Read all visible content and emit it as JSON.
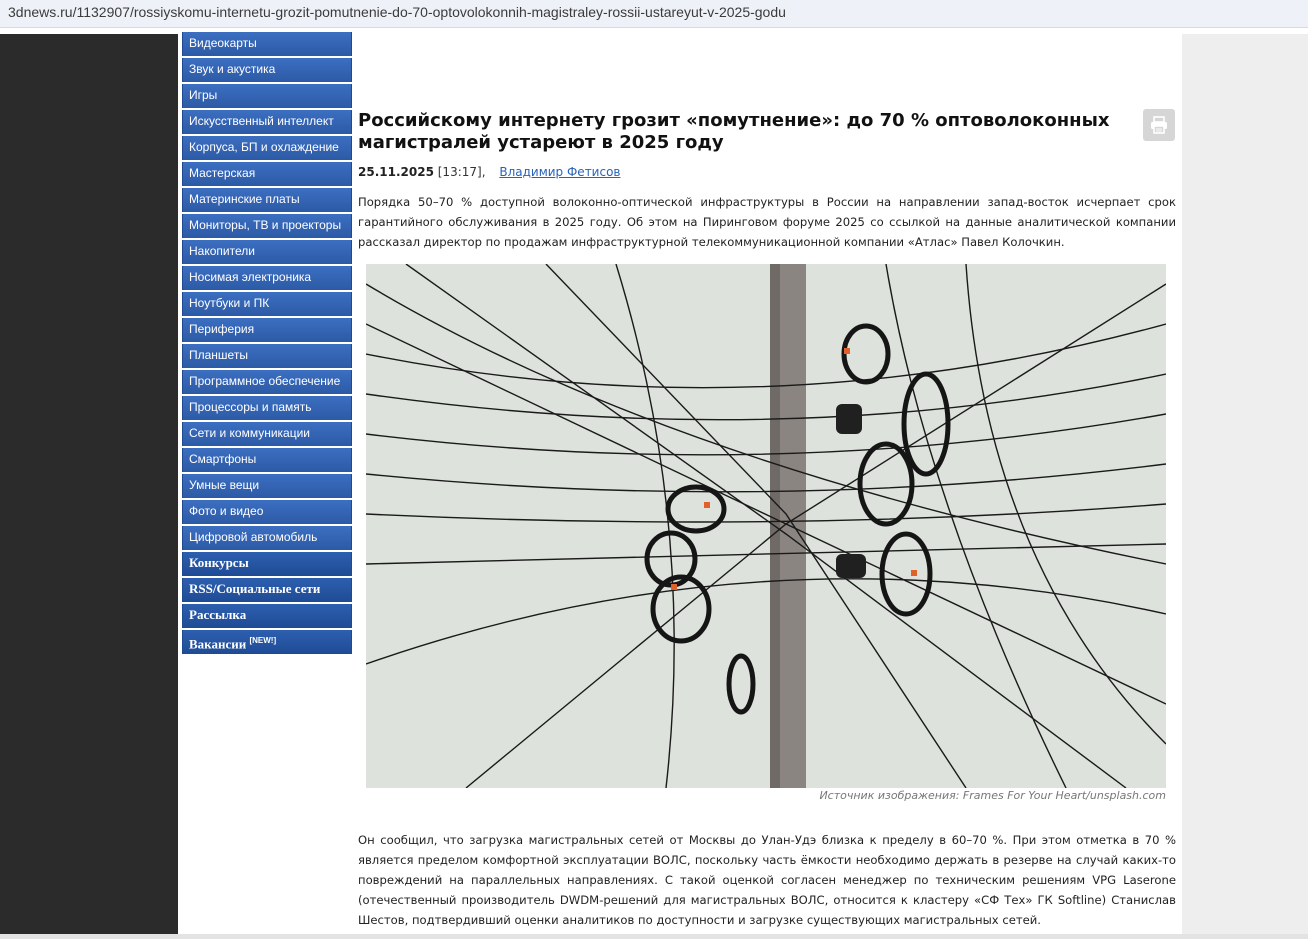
{
  "browser": {
    "url": "3dnews.ru/1132907/rossiyskomu-internetu-grozit-pomutnenie-do-70-optovolokonnih-magistraley-rossii-ustareyut-v-2025-godu"
  },
  "sidebar": {
    "items": [
      {
        "label": "Видеокарты"
      },
      {
        "label": "Звук и акустика"
      },
      {
        "label": "Игры"
      },
      {
        "label": "Искусственный интеллект"
      },
      {
        "label": "Корпуса, БП и охлаждение"
      },
      {
        "label": "Мастерская"
      },
      {
        "label": "Материнские платы"
      },
      {
        "label": "Мониторы, ТВ и проекторы"
      },
      {
        "label": "Накопители"
      },
      {
        "label": "Носимая электроника"
      },
      {
        "label": "Ноутбуки и ПК"
      },
      {
        "label": "Периферия"
      },
      {
        "label": "Планшеты"
      },
      {
        "label": "Программное обеспечение"
      },
      {
        "label": "Процессоры и память"
      },
      {
        "label": "Сети и коммуникации"
      },
      {
        "label": "Смартфоны"
      },
      {
        "label": "Умные вещи"
      },
      {
        "label": "Фото и видео"
      },
      {
        "label": "Цифровой автомобиль"
      }
    ],
    "bold_items": [
      {
        "label": "Конкурсы"
      },
      {
        "label": "RSS/Социальные сети"
      },
      {
        "label": "Рассылка"
      },
      {
        "label": "Вакансии",
        "badge": "[NEW!]"
      }
    ]
  },
  "article": {
    "title": "Российскому интернету грозит «помутнение»: до 70 % оптоволоконных магистралей устареют в 2025 году",
    "date": "25.11.2025",
    "time": "[13:17],",
    "author": "Владимир Фетисов",
    "lead": "Порядка 50–70 % доступной волоконно-оптической инфраструктуры в России на направлении запад-восток исчерпает срок гарантийного обслуживания в 2025 году. Об этом на Пиринговом форуме 2025 со ссылкой на данные аналитической компании рассказал директор по продажам инфраструктурной телекоммуникационной компании «Атлас» Павел Колочкин.",
    "image_caption": "Источник изображения: Frames For Your Heart/unsplash.com",
    "body": "Он сообщил, что загрузка магистральных сетей от Москвы до Улан-Удэ близка к пределу в 60–70 %. При этом отметка в 70 % является пределом комфортной эксплуатации ВОЛС, поскольку часть ёмкости необходимо держать в резерве на случай каких-то повреждений на параллельных направлениях. С такой оценкой согласен менеджер по техническим решениям VPG Laserone (отечественный производитель DWDM-решений для магистральных ВОЛС, относится к кластеру «СФ Тех» ГК Softline) Станислав Шестов, подтвердивший оценки аналитиков по доступности и загрузке существующих магистральных сетей."
  },
  "icons": {
    "print": "printer-icon"
  },
  "colors": {
    "nav_bg": "#2c5aa6",
    "link": "#2a62b8",
    "left_bg": "#2b2b2b",
    "right_bg": "#eeeeee"
  }
}
